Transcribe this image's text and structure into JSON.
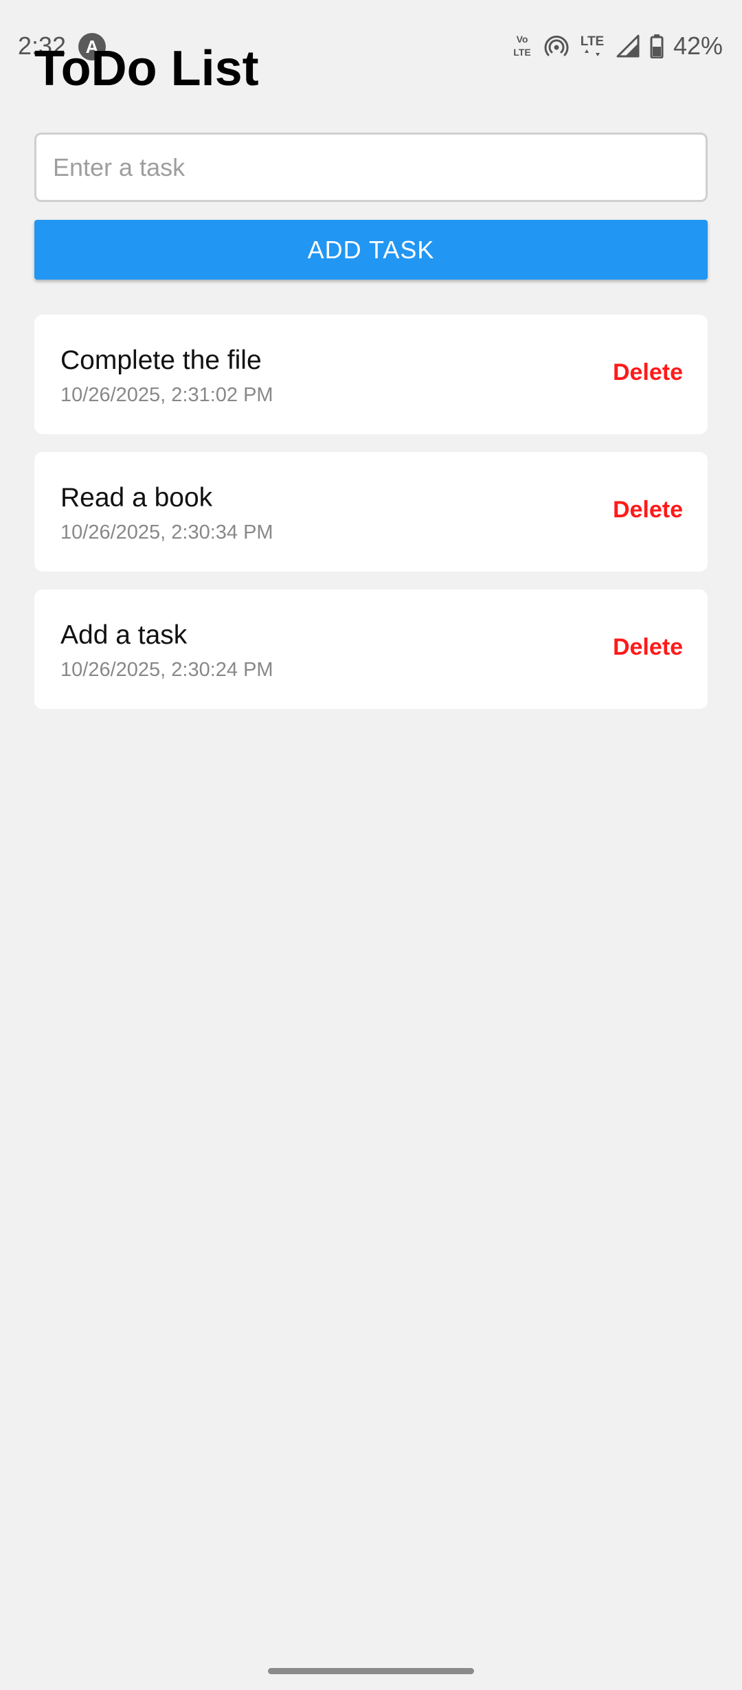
{
  "status_bar": {
    "time": "2:32",
    "app_icon_glyph": "A",
    "icons": [
      "volte-icon",
      "hotspot-icon",
      "lte-icon",
      "signal-icon",
      "battery-icon"
    ],
    "volte_top": "Vo",
    "volte_bottom": "LTE",
    "lte_label": "LTE",
    "battery": "42%"
  },
  "page": {
    "title": "ToDo List"
  },
  "input": {
    "placeholder": "Enter a task",
    "value": ""
  },
  "add_button": {
    "label": "ADD TASK"
  },
  "tasks": [
    {
      "text": "Complete the file",
      "date": "10/26/2025, 2:31:02 PM",
      "delete_label": "Delete"
    },
    {
      "text": "Read a book",
      "date": "10/26/2025, 2:30:34 PM",
      "delete_label": "Delete"
    },
    {
      "text": "Add a task",
      "date": "10/26/2025, 2:30:24 PM",
      "delete_label": "Delete"
    }
  ],
  "colors": {
    "background": "#f1f1f1",
    "accent": "#2196f3",
    "delete": "#ff1a1a",
    "card": "#ffffff"
  }
}
